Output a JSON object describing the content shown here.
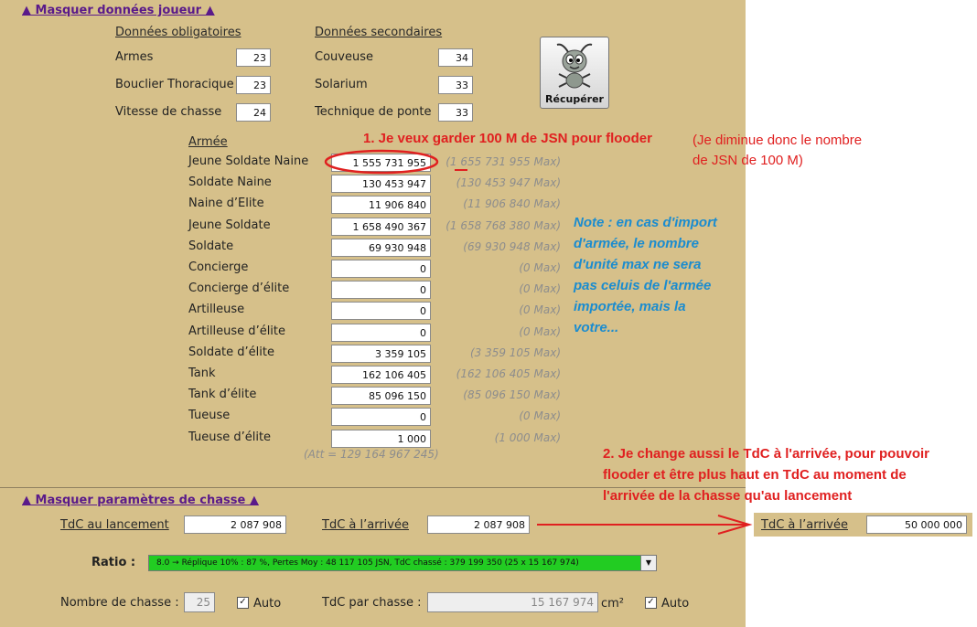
{
  "player_toggle": "▲ Masquer données joueur ▲",
  "mandatory": {
    "heading": "Données obligatoires",
    "rows": [
      {
        "label": "Armes",
        "value": "23"
      },
      {
        "label": "Bouclier Thoracique",
        "value": "23"
      },
      {
        "label": "Vitesse de chasse",
        "value": "24"
      }
    ]
  },
  "secondary": {
    "heading": "Données secondaires",
    "rows": [
      {
        "label": "Couveuse",
        "value": "34"
      },
      {
        "label": "Solarium",
        "value": "33"
      },
      {
        "label": "Technique de ponte",
        "value": "33"
      }
    ]
  },
  "recover_button": {
    "label": "Récupérer",
    "icon": "ant-icon"
  },
  "army": {
    "heading": "Armée",
    "units": [
      {
        "label": "Jeune Soldate Naine",
        "value": "1 555 731 955",
        "max": "(1 655 731 955 Max)"
      },
      {
        "label": "Soldate Naine",
        "value": "130 453 947",
        "max": "(130 453 947 Max)"
      },
      {
        "label": "Naine d’Elite",
        "value": "11 906 840",
        "max": "(11 906 840 Max)"
      },
      {
        "label": "Jeune Soldate",
        "value": "1 658 490 367",
        "max": "(1 658 768 380 Max)"
      },
      {
        "label": "Soldate",
        "value": "69 930 948",
        "max": "(69 930 948 Max)"
      },
      {
        "label": "Concierge",
        "value": "0",
        "max": "(0 Max)"
      },
      {
        "label": "Concierge d’élite",
        "value": "0",
        "max": "(0 Max)"
      },
      {
        "label": "Artilleuse",
        "value": "0",
        "max": "(0 Max)"
      },
      {
        "label": "Artilleuse d’élite",
        "value": "0",
        "max": "(0 Max)"
      },
      {
        "label": "Soldate d’élite",
        "value": "3 359 105",
        "max": "(3 359 105 Max)"
      },
      {
        "label": "Tank",
        "value": "162 106 405",
        "max": "(162 106 405 Max)"
      },
      {
        "label": "Tank d’élite",
        "value": "85 096 150",
        "max": "(85 096 150 Max)"
      },
      {
        "label": "Tueuse",
        "value": "0",
        "max": "(0 Max)"
      },
      {
        "label": "Tueuse d’élite",
        "value": "1 000",
        "max": "(1 000 Max)"
      }
    ],
    "att_total": "(Att = 129 164 967 245)"
  },
  "annotations": {
    "a1": "1. Je veux garder 100 M de JSN pour flooder",
    "a1_side_1": "(Je diminue donc le nombre",
    "a1_side_2": "de JSN de 100 M)",
    "note_lines": [
      "Note : en cas d'import",
      "d'armée, le nombre",
      "d'unité max ne sera",
      "pas celuis de l'armée",
      "importée, mais la",
      "votre..."
    ],
    "a2_lines": [
      "2. Je change aussi le TdC à l'arrivée, pour pouvoir",
      "flooder et être plus haut en TdC au moment de",
      "l'arrivée de la chasse qu'au lancement"
    ]
  },
  "hunt": {
    "toggle": "▲ Masquer paramètres de chasse ▲",
    "tdc_launch_label": "TdC au lancement",
    "tdc_launch_value": "2 087 908",
    "tdc_arrival_label": "TdC à l’arrivée",
    "tdc_arrival_value": "2 087 908",
    "tdc_arrival_new_label": "TdC à l’arrivée",
    "tdc_arrival_new_value": "50 000 000",
    "ratio_label": "Ratio :",
    "ratio_value": "8.0 → Réplique 10% : 87 %, Pertes Moy :    48 117 105 JSN, TdC chassé :   379 199 350 (25 x 15 167 974)",
    "hunt_count_label": "Nombre de chasse :",
    "hunt_count_value": "25",
    "auto_label_1": "Auto",
    "tdc_per_hunt_label": "TdC par chasse :",
    "tdc_per_hunt_value": "15 167 974",
    "unit": "cm²",
    "auto_label_2": "Auto",
    "checkmark": "✓"
  },
  "colors": {
    "panel": "#d6c08a",
    "annotation_red": "#e02020",
    "annotation_blue": "#1b8ccf",
    "ratio_green": "#22cc22",
    "link_purple": "#5a1a8a"
  }
}
